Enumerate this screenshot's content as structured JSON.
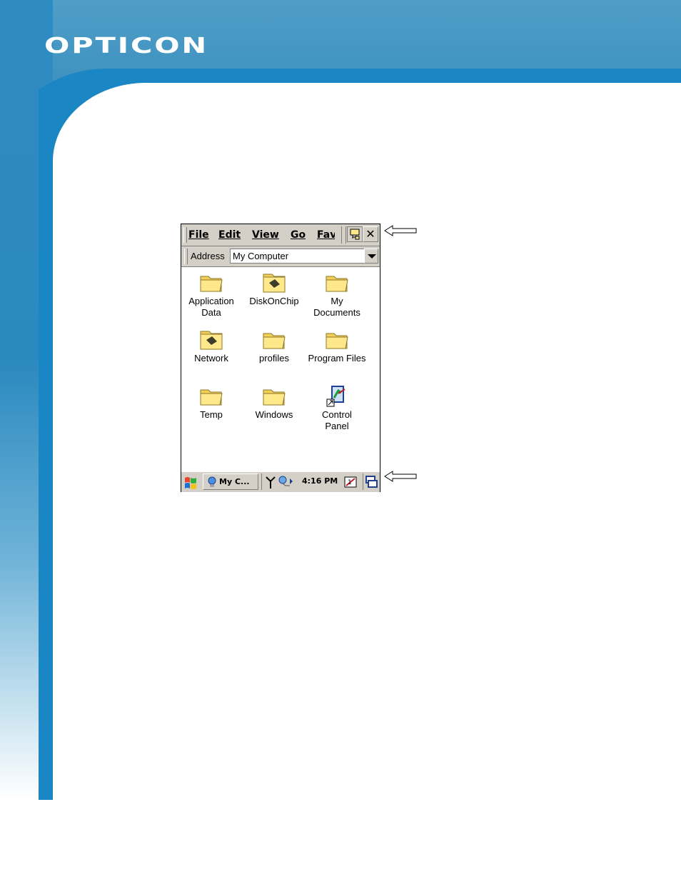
{
  "brand": {
    "logo_text": "OPTICON"
  },
  "menubar": {
    "items": [
      "File",
      "Edit",
      "View",
      "Go",
      "Fav"
    ]
  },
  "address": {
    "label": "Address",
    "value": "My Computer"
  },
  "items": [
    {
      "label": "Application\nData",
      "icon": "folder-icon"
    },
    {
      "label": "DiskOnChip",
      "icon": "storage-card-icon"
    },
    {
      "label": "My\nDocuments",
      "icon": "folder-icon"
    },
    {
      "label": "Network",
      "icon": "network-storage-icon"
    },
    {
      "label": "profiles",
      "icon": "folder-icon"
    },
    {
      "label": "Program Files",
      "icon": "folder-icon"
    },
    {
      "label": "Temp",
      "icon": "folder-icon"
    },
    {
      "label": "Windows",
      "icon": "folder-icon"
    },
    {
      "label": "Control\nPanel",
      "icon": "control-panel-shortcut-icon"
    }
  ],
  "taskbar": {
    "task_label": "My C...",
    "clock": "4:16 PM"
  },
  "colors": {
    "header_blue": "#3f92bf",
    "curve_blue": "#1b86c4",
    "chrome": "#d4d0c8"
  }
}
